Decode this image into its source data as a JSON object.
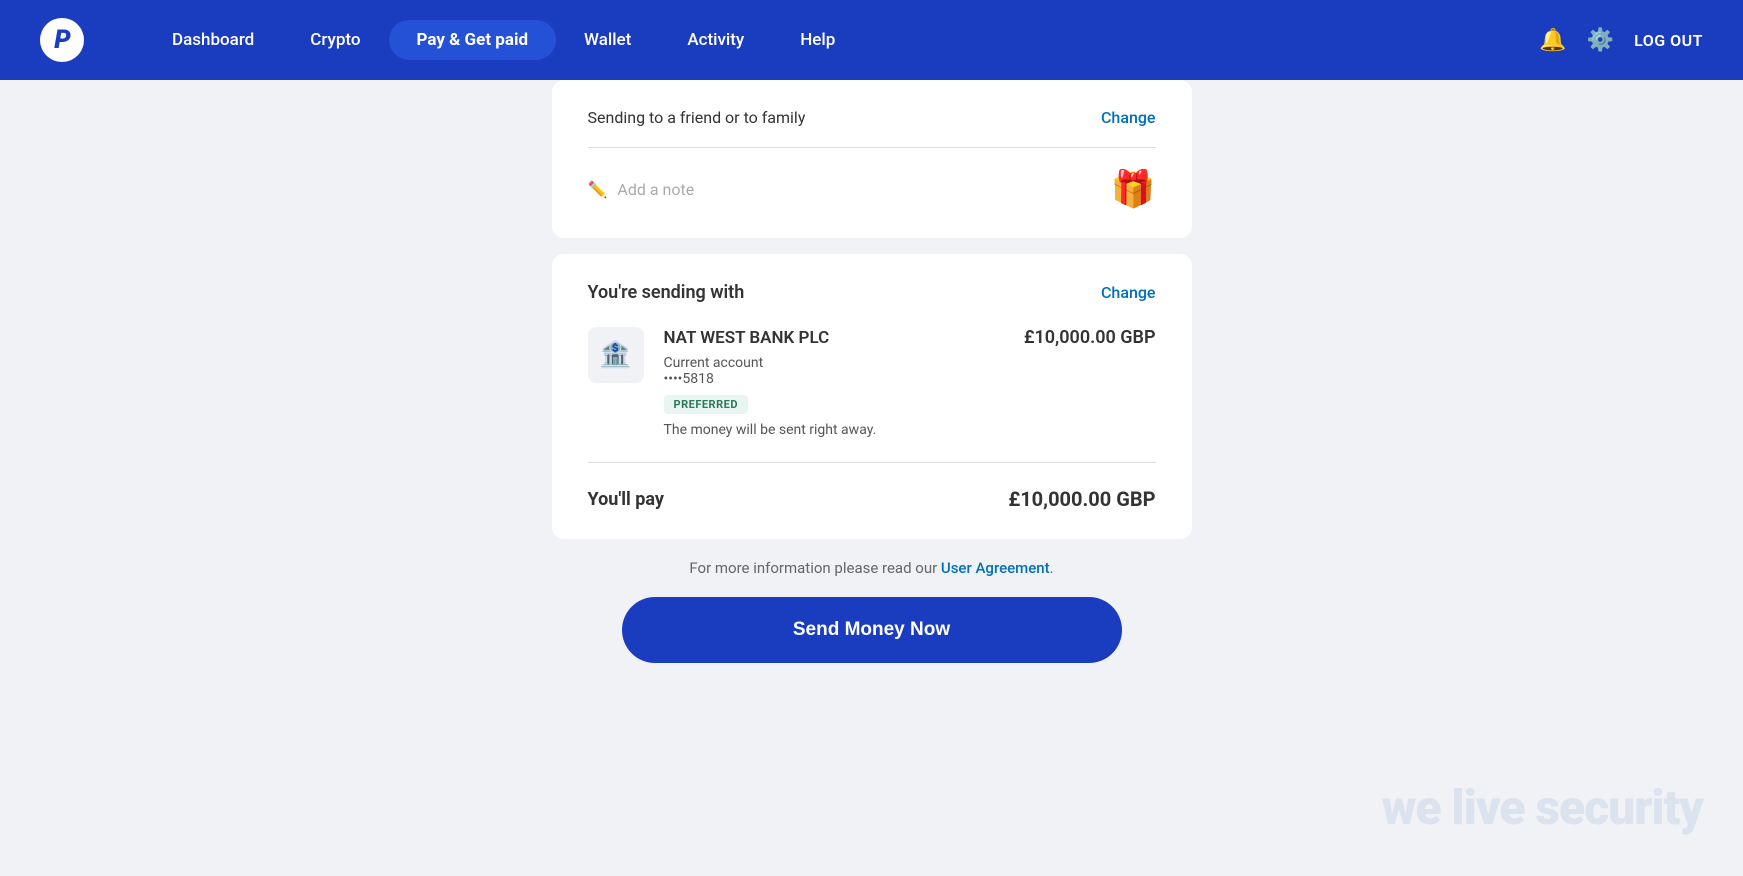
{
  "nav": {
    "logo": "P",
    "items": [
      {
        "label": "Dashboard",
        "active": false
      },
      {
        "label": "Crypto",
        "active": false
      },
      {
        "label": "Pay & Get paid",
        "active": true
      },
      {
        "label": "Wallet",
        "active": false
      },
      {
        "label": "Activity",
        "active": false
      },
      {
        "label": "Help",
        "active": false
      }
    ],
    "logout_label": "LOG OUT"
  },
  "sending_section": {
    "sending_type": "Sending to a friend or to family",
    "change_label": "Change"
  },
  "note_section": {
    "placeholder": "Add a note"
  },
  "sending_with_section": {
    "title": "You're sending with",
    "change_label": "Change",
    "bank_name": "NAT WEST BANK PLC",
    "bank_type": "Current account",
    "account_last4": "••••5818",
    "preferred_badge": "PREFERRED",
    "send_info": "The money will be sent right away.",
    "amount": "£10,000.00 GBP"
  },
  "payment_section": {
    "label": "You'll pay",
    "amount": "£10,000.00 GBP"
  },
  "footer": {
    "text": "For more information please read our ",
    "link_label": "User Agreement",
    "link_suffix": "."
  },
  "send_button": {
    "label": "Send Money Now"
  },
  "watermark": {
    "text": "we live security"
  }
}
